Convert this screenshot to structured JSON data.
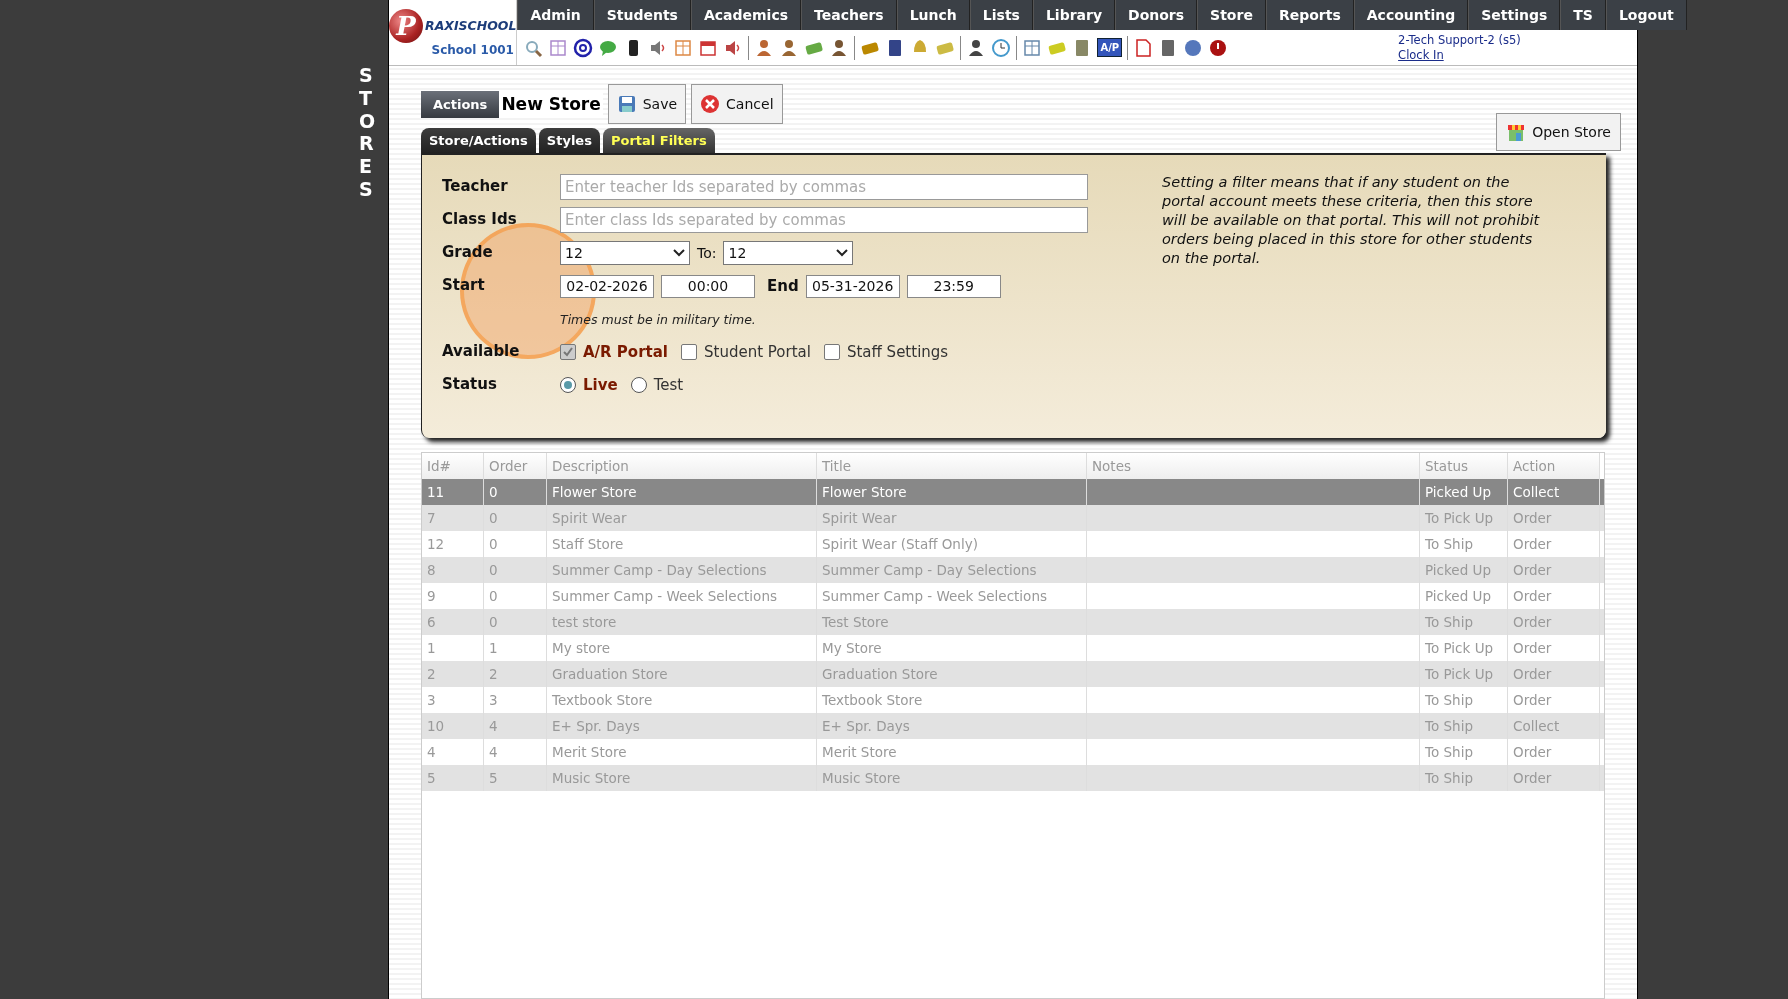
{
  "side_title": "STORES",
  "logo": {
    "letter": "P",
    "wordmark": "RAXISCHOOL",
    "school": "School 1001"
  },
  "nav": [
    "Admin",
    "Students",
    "Academics",
    "Teachers",
    "Lunch",
    "Lists",
    "Library",
    "Donors",
    "Store",
    "Reports",
    "Accounting",
    "Settings",
    "TS",
    "Logout"
  ],
  "toolbar": {
    "ap_badge": "A/P"
  },
  "user": {
    "name": "2-Tech Support-2 (s5)",
    "clock_link": "Clock In"
  },
  "actions": {
    "menu": "Actions",
    "title": "New Store",
    "save": "Save",
    "cancel": "Cancel",
    "open_store": "Open Store"
  },
  "tabs": [
    {
      "label": "Store/Actions",
      "selected": false
    },
    {
      "label": "Styles",
      "selected": false
    },
    {
      "label": "Portal Filters",
      "selected": true
    }
  ],
  "form": {
    "teacher": {
      "label": "Teacher",
      "placeholder": "Enter teacher Ids separated by commas"
    },
    "class_ids": {
      "label": "Class Ids",
      "placeholder": "Enter class Ids separated by commas"
    },
    "grade": {
      "label": "Grade",
      "from": "12",
      "to_label": "To:",
      "to": "12"
    },
    "start": {
      "label": "Start",
      "date": "02-02-2026",
      "time": "00:00",
      "end_label": "End",
      "end_date": "05-31-2026",
      "end_time": "23:59"
    },
    "time_note": "Times must be in military time.",
    "available": {
      "label": "Available",
      "options": [
        {
          "label": "A/R Portal",
          "checked": true,
          "disabled": true
        },
        {
          "label": "Student Portal",
          "checked": false,
          "disabled": false
        },
        {
          "label": "Staff Settings",
          "checked": false,
          "disabled": false
        }
      ]
    },
    "status": {
      "label": "Status",
      "options": [
        {
          "label": "Live",
          "selected": true
        },
        {
          "label": "Test",
          "selected": false
        }
      ]
    },
    "help": "Setting a filter means that if any student on the portal account meets these criteria, then this store will be available on that portal. This will not prohibit orders being placed in this store for other students on the portal."
  },
  "table": {
    "columns": [
      "Id#",
      "Order",
      "Description",
      "Title",
      "Notes",
      "Status",
      "Action"
    ],
    "rows": [
      {
        "cells": [
          "11",
          "0",
          "Flower Store",
          "Flower Store",
          "",
          "Picked Up",
          "Collect"
        ],
        "selected": true
      },
      {
        "cells": [
          "7",
          "0",
          "Spirit Wear",
          "Spirit Wear",
          "",
          "To Pick Up",
          "Order"
        ],
        "selected": false
      },
      {
        "cells": [
          "12",
          "0",
          "Staff Store",
          "Spirit Wear (Staff Only)",
          "",
          "To Ship",
          "Order"
        ],
        "selected": false
      },
      {
        "cells": [
          "8",
          "0",
          "Summer Camp - Day Selections",
          "Summer Camp - Day Selections",
          "",
          "Picked Up",
          "Order"
        ],
        "selected": false
      },
      {
        "cells": [
          "9",
          "0",
          "Summer Camp - Week Selections",
          "Summer Camp - Week Selections",
          "",
          "Picked Up",
          "Order"
        ],
        "selected": false
      },
      {
        "cells": [
          "6",
          "0",
          "test store",
          "Test Store",
          "",
          "To Ship",
          "Order"
        ],
        "selected": false
      },
      {
        "cells": [
          "1",
          "1",
          "My store",
          "My Store",
          "",
          "To Pick Up",
          "Order"
        ],
        "selected": false
      },
      {
        "cells": [
          "2",
          "2",
          "Graduation Store",
          "Graduation Store",
          "",
          "To Pick Up",
          "Order"
        ],
        "selected": false
      },
      {
        "cells": [
          "3",
          "3",
          "Textbook Store",
          "Textbook Store",
          "",
          "To Ship",
          "Order"
        ],
        "selected": false
      },
      {
        "cells": [
          "10",
          "4",
          "E+ Spr. Days",
          "E+ Spr. Days",
          "",
          "To Ship",
          "Collect"
        ],
        "selected": false
      },
      {
        "cells": [
          "4",
          "4",
          "Merit Store",
          "Merit Store",
          "",
          "To Ship",
          "Order"
        ],
        "selected": false
      },
      {
        "cells": [
          "5",
          "5",
          "Music Store",
          "Music Store",
          "",
          "To Ship",
          "Order"
        ],
        "selected": false
      }
    ]
  }
}
